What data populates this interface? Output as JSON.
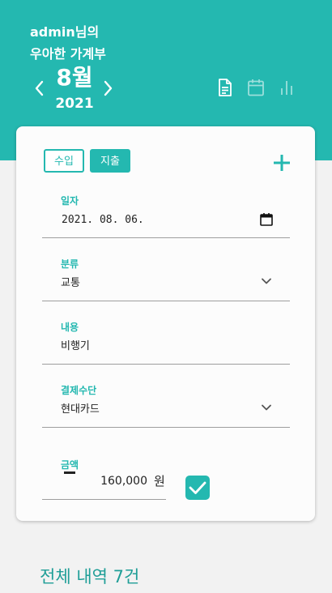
{
  "header": {
    "title_line1": "admin님의",
    "title_line2": "우아한 가계부",
    "month": "8월",
    "year": "2021",
    "icons": [
      "document-icon",
      "calendar-icon",
      "bar-chart-icon"
    ]
  },
  "form": {
    "type_buttons": {
      "income": "수입",
      "expense": "지출"
    },
    "fields": {
      "date": {
        "label": "일자",
        "value": "2021. 08. 06."
      },
      "category": {
        "label": "분류",
        "value": "교통"
      },
      "content": {
        "label": "내용",
        "value": "비행기"
      },
      "payment": {
        "label": "결제수단",
        "value": "현대카드"
      },
      "amount": {
        "label": "금액",
        "value": "160,000",
        "currency": "원"
      }
    }
  },
  "summary": {
    "text": "전체 내역 7건"
  },
  "colors": {
    "accent": "#24b8b0",
    "accent_dark": "#1f9e97"
  }
}
